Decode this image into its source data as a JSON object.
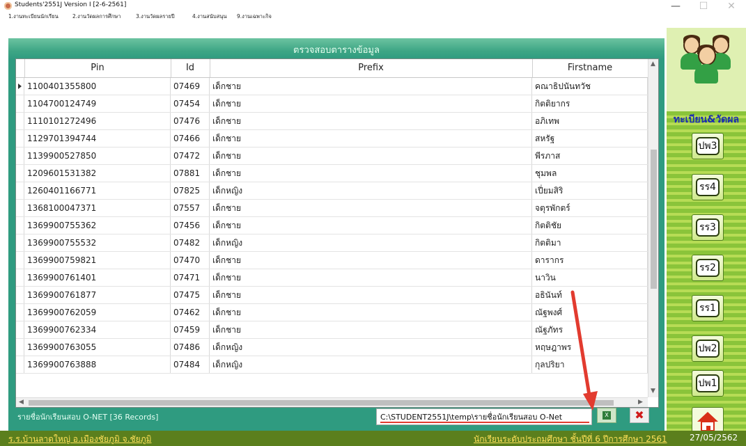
{
  "window": {
    "title": "Students'2551J Version I [2-6-2561]",
    "minimize": "—",
    "maximize": "☐",
    "close": "✕"
  },
  "menu": [
    "1.งานทะเบียนนักเรียน",
    "2.งานวัดผลการศึกษา",
    "3.งานวัดผลรายปี",
    "4.งานสนับสนุน",
    "9.งานเฉพาะกิจ"
  ],
  "header": {
    "title": "ตรวจสอบตารางข้อมูล"
  },
  "table": {
    "columns": [
      "Pin",
      "Id",
      "Prefix",
      "Firstname"
    ],
    "rows": [
      [
        "1100401355800",
        "07469",
        "เด็กชาย",
        "คณาธิปนันทวัช"
      ],
      [
        "1104700124749",
        "07454",
        "เด็กชาย",
        "กิตติยากร"
      ],
      [
        "1110101272496",
        "07476",
        "เด็กชาย",
        "อภิเทพ"
      ],
      [
        "1129701394744",
        "07466",
        "เด็กชาย",
        "สหรัฐ"
      ],
      [
        "1139900527850",
        "07472",
        "เด็กชาย",
        "พีรภาส"
      ],
      [
        "1209601531382",
        "07881",
        "เด็กชาย",
        "ชุมพล"
      ],
      [
        "1260401166771",
        "07825",
        "เด็กหญิง",
        "เปี่ยมสิริ"
      ],
      [
        "1368100047371",
        "07557",
        "เด็กชาย",
        "จตุรพักตร์"
      ],
      [
        "1369900755362",
        "07456",
        "เด็กชาย",
        "กิตติชัย"
      ],
      [
        "1369900755532",
        "07482",
        "เด็กหญิง",
        "กิตติมา"
      ],
      [
        "1369900759821",
        "07470",
        "เด็กชาย",
        "ดารากร"
      ],
      [
        "1369900761401",
        "07471",
        "เด็กชาย",
        "นาวิน"
      ],
      [
        "1369900761877",
        "07475",
        "เด็กชาย",
        "อธินันท์"
      ],
      [
        "1369900762059",
        "07462",
        "เด็กชาย",
        "ณัฐพงศ์"
      ],
      [
        "1369900762334",
        "07459",
        "เด็กชาย",
        "ณัฐภัทร"
      ],
      [
        "1369900763055",
        "07486",
        "เด็กหญิง",
        "หฤษฎาพร"
      ],
      [
        "1369900763888",
        "07484",
        "เด็กหญิง",
        "กุลปริยา"
      ]
    ]
  },
  "status": {
    "records": "รายชื่อนักเรียนสอบ O-NET [36 Records]",
    "export_path": "C:\\STUDENT2551J\\temp\\รายชื่อนักเรียนสอบ O-Net",
    "excel_icon": "excel-icon",
    "close_icon": "close-icon"
  },
  "sidebar": {
    "label": "ทะเบียน&วัดผล",
    "buttons": [
      "ปพ3",
      "รร4",
      "รร3",
      "รร2",
      "รร1",
      "ปพ2",
      "ปพ1"
    ],
    "home_icon": "home-icon"
  },
  "footer": {
    "school": "ร.ร.บ้านลาดใหญ่  อ.เมืองชัยภูมิ  จ.ชัยภูมิ",
    "level": "นักเรียนระดับประถมศึกษา  ชั้นปีที่ 6  ปีการศึกษา 2561",
    "date": "27/05/2562"
  },
  "colors": {
    "accent": "#2f9b80",
    "footer": "#5b7f1d",
    "annotation": "#e23b2f"
  }
}
